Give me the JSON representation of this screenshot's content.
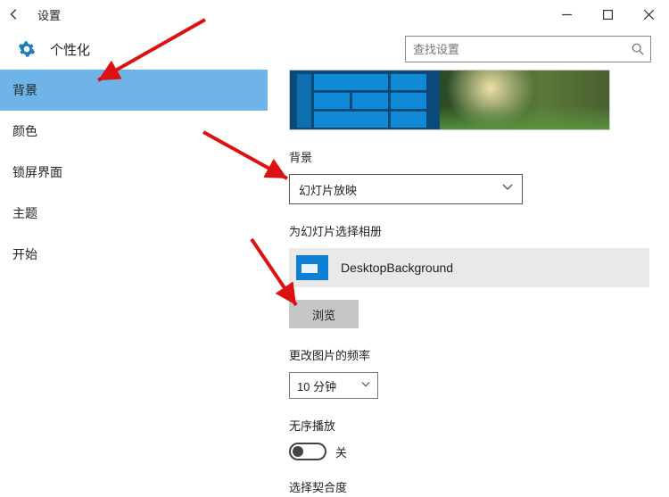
{
  "window": {
    "title": "设置"
  },
  "header": {
    "page_title": "个性化"
  },
  "search": {
    "placeholder": "查找设置"
  },
  "sidebar": {
    "items": [
      {
        "label": "背景"
      },
      {
        "label": "颜色"
      },
      {
        "label": "锁屏界面"
      },
      {
        "label": "主题"
      },
      {
        "label": "开始"
      }
    ]
  },
  "content": {
    "background_label": "背景",
    "background_select": "幻灯片放映",
    "album_label": "为幻灯片选择相册",
    "album_name": "DesktopBackground",
    "browse_btn": "浏览",
    "freq_label": "更改图片的频率",
    "freq_value": "10 分钟",
    "shuffle_label": "无序播放",
    "shuffle_state_text": "关",
    "fit_label": "选择契合度"
  }
}
